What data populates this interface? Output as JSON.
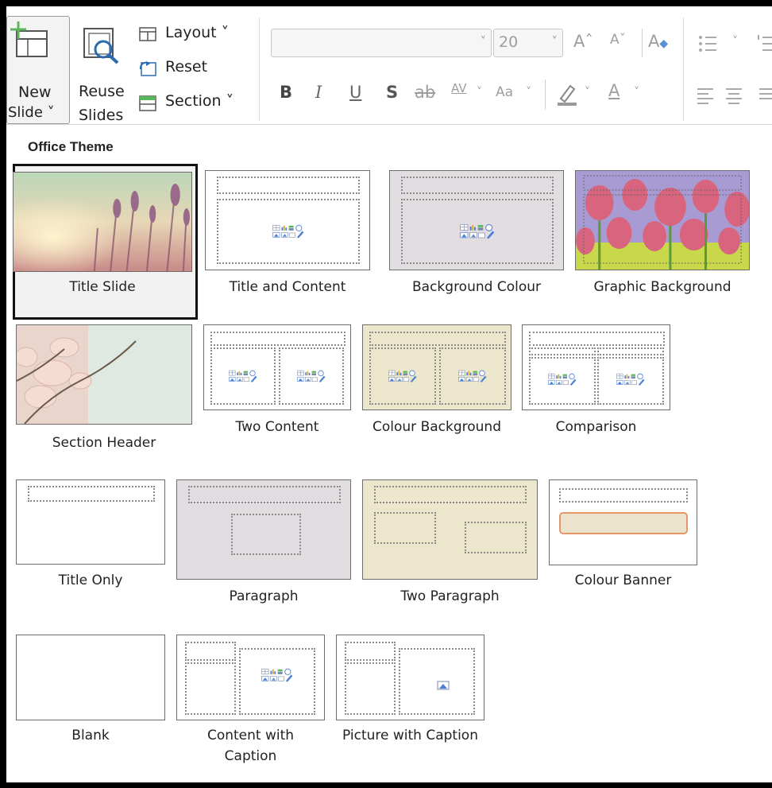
{
  "ribbon": {
    "new_slide_label_1": "New",
    "new_slide_label_2": "Slide ˅",
    "reuse_label_1": "Reuse",
    "reuse_label_2": "Slides",
    "layout_label": "Layout ˅",
    "reset_label": "Reset",
    "section_label": "Section ˅",
    "font_size_value": "20",
    "bold": "B",
    "italic": "I",
    "underline": "U",
    "shadow": "S",
    "strike": "ab",
    "spacing": "AV",
    "change_case": "Aa",
    "grow_font": "Aˆ",
    "shrink_font": "Aˇ",
    "clear_format": "A",
    "font_color": "A",
    "chevron": "˅"
  },
  "gallery": {
    "theme_title": "Office Theme",
    "layouts": [
      {
        "label": "Title Slide"
      },
      {
        "label": "Title and Content"
      },
      {
        "label": "Background Colour"
      },
      {
        "label": "Graphic Background"
      },
      {
        "label": "Section Header"
      },
      {
        "label": "Two Content"
      },
      {
        "label": "Colour Background"
      },
      {
        "label": "Comparison"
      },
      {
        "label": "Title Only"
      },
      {
        "label": "Paragraph"
      },
      {
        "label": "Two Paragraph"
      },
      {
        "label": "Colour Banner"
      },
      {
        "label": "Blank"
      },
      {
        "label": "Content with\nCaption"
      },
      {
        "label": "Picture with Caption"
      }
    ]
  },
  "colors": {
    "gray_bg": "#e2dde0",
    "beige_bg": "#ebe6cc",
    "banner_fill": "#ebe3cc",
    "banner_border": "#e8956a",
    "accent_green": "#5bb75b"
  }
}
